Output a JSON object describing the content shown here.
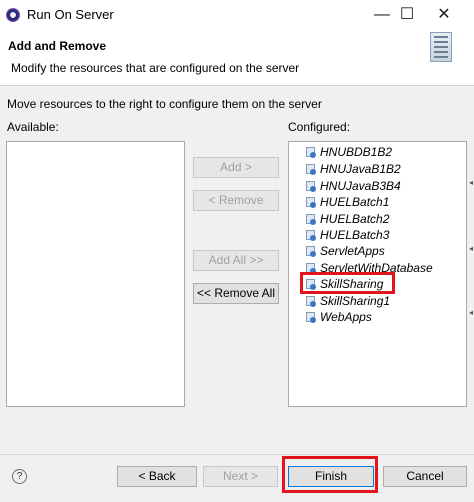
{
  "window": {
    "title": "Run On Server",
    "minimize_glyph": "—",
    "maximize_glyph": "☐",
    "close_glyph": "✕"
  },
  "header": {
    "title": "Add and Remove",
    "subtitle": "Modify the resources that are configured on the server"
  },
  "instruction": "Move resources to the right to configure them on the server",
  "available": {
    "label": "Available:",
    "items": []
  },
  "configured": {
    "label": "Configured:",
    "items": [
      "HNUBDB1B2",
      "HNUJavaB1B2",
      "HNUJavaB3B4",
      "HUELBatch1",
      "HUELBatch2",
      "HUELBatch3",
      "ServletApps",
      "ServletWithDatabase",
      "SkillSharing",
      "SkillSharing1",
      "WebApps"
    ],
    "highlighted_item": "SkillSharing"
  },
  "buttons": {
    "add": "Add >",
    "remove": "< Remove",
    "add_all": "Add All >>",
    "remove_all": "<< Remove All",
    "back": "< Back",
    "next": "Next >",
    "finish": "Finish",
    "cancel": "Cancel"
  },
  "help": {
    "glyph": "?"
  },
  "icons": {
    "app": "eclipse-icon",
    "wizard": "server-icon",
    "project": "web-project-icon",
    "help": "help-icon"
  },
  "colors": {
    "highlight": "#e3141b",
    "default_button_border": "#0078d7",
    "disabled_text": "#a0a0a0"
  }
}
